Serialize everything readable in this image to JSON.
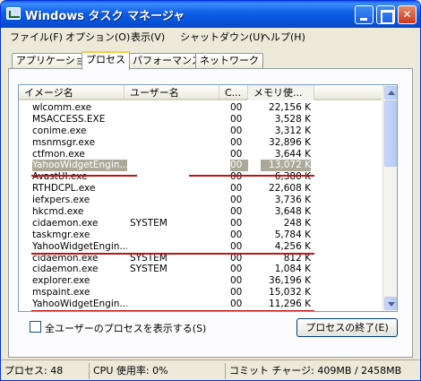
{
  "window": {
    "title": "Windows タスク マネージャ",
    "minimize_icon": "minimize-icon",
    "maximize_icon": "maximize-icon",
    "close_icon": "close-icon"
  },
  "menu": {
    "items": [
      {
        "label": "ファイル(F)"
      },
      {
        "label": "オプション(O)"
      },
      {
        "label": "表示(V)"
      },
      {
        "label": "シャットダウン(U)"
      },
      {
        "label": "ヘルプ(H)"
      }
    ]
  },
  "tabs": [
    {
      "label": "アプリケーション"
    },
    {
      "label": "プロセス"
    },
    {
      "label": "パフォーマンス"
    },
    {
      "label": "ネットワーク"
    }
  ],
  "active_tab": "プロセス",
  "table": {
    "columns": [
      "イメージ名",
      "ユーザー名",
      "C...",
      "メモリ使..."
    ],
    "rows": [
      {
        "name": "wlcomm.exe",
        "user": "",
        "cpu": "00",
        "mem": "22,156 K"
      },
      {
        "name": "MSACCESS.EXE",
        "user": "",
        "cpu": "00",
        "mem": "3,528 K"
      },
      {
        "name": "conime.exe",
        "user": "",
        "cpu": "00",
        "mem": "3,312 K"
      },
      {
        "name": "msnmsgr.exe",
        "user": "",
        "cpu": "00",
        "mem": "32,896 K"
      },
      {
        "name": "ctfmon.exe",
        "user": "",
        "cpu": "00",
        "mem": "3,644 K"
      },
      {
        "name": "YahooWidgetEngin...",
        "user": "",
        "cpu": "00",
        "mem": "13,072 K"
      },
      {
        "name": "AvastUI.exe",
        "user": "",
        "cpu": "00",
        "mem": "6,380 K"
      },
      {
        "name": "RTHDCPL.exe",
        "user": "",
        "cpu": "00",
        "mem": "22,608 K"
      },
      {
        "name": "iefxpers.exe",
        "user": "",
        "cpu": "00",
        "mem": "3,736 K"
      },
      {
        "name": "hkcmd.exe",
        "user": "",
        "cpu": "00",
        "mem": "3,648 K"
      },
      {
        "name": "cidaemon.exe",
        "user": "SYSTEM",
        "cpu": "00",
        "mem": "248 K"
      },
      {
        "name": "taskmgr.exe",
        "user": "",
        "cpu": "00",
        "mem": "5,784 K"
      },
      {
        "name": "YahooWidgetEngin...",
        "user": "",
        "cpu": "00",
        "mem": "4,256 K"
      },
      {
        "name": "cidaemon.exe",
        "user": "SYSTEM",
        "cpu": "00",
        "mem": "812 K"
      },
      {
        "name": "cidaemon.exe",
        "user": "SYSTEM",
        "cpu": "00",
        "mem": "1,084 K"
      },
      {
        "name": "explorer.exe",
        "user": "",
        "cpu": "00",
        "mem": "36,196 K"
      },
      {
        "name": "mspaint.exe",
        "user": "",
        "cpu": "00",
        "mem": "15,032 K"
      },
      {
        "name": "YahooWidgetEngin...",
        "user": "",
        "cpu": "00",
        "mem": "11,296 K"
      }
    ],
    "selected_row": 5,
    "highlight_color": "#c21212"
  },
  "show_all_users_label": "全ユーザーのプロセスを表示する(S)",
  "end_process_label": "プロセスの終了(E)",
  "status": {
    "processes": "プロセス: 48",
    "cpu": "CPU 使用率: 0%",
    "commit": "コミット チャージ: 409MB / 2458MB"
  }
}
